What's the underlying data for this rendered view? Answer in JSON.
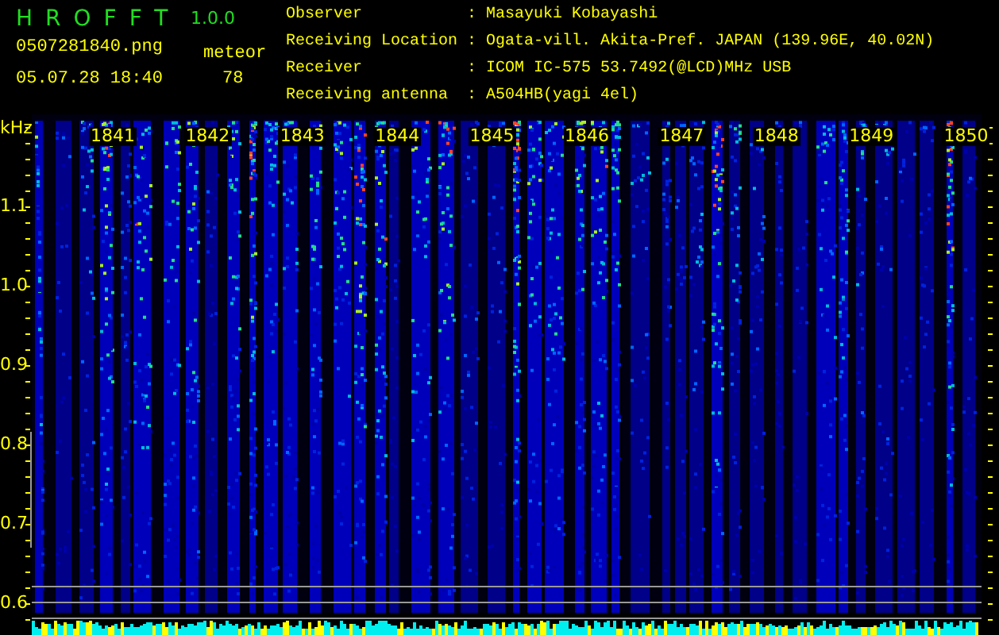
{
  "app": {
    "title": "HROFFT",
    "version": "1.0.0"
  },
  "file": {
    "name": "0507281840.png",
    "datetime": "05.07.28 18:40"
  },
  "meteor": {
    "label": "meteor",
    "count": "78"
  },
  "station_info": [
    {
      "label": "Observer",
      "separator": ":",
      "value": "Masayuki Kobayashi"
    },
    {
      "label": "Receiving Location",
      "separator": ":",
      "value": "Ogata-vill. Akita-Pref. JAPAN (139.96E, 40.02N)"
    },
    {
      "label": "Receiver",
      "separator": ":",
      "value": "ICOM IC-575 53.7492(@LCD)MHz USB"
    },
    {
      "label": "Receiving antenna",
      "separator": ":",
      "value": "A504HB(yagi 4el)"
    }
  ],
  "spectrogram": {
    "y_unit": "kHz",
    "y_ticks": [
      "1.1",
      "1.0",
      "0.9",
      "0.8",
      "0.7",
      "0.6"
    ],
    "time_labels": [
      "1841",
      "1842",
      "1843",
      "1844",
      "1845",
      "1846",
      "1847",
      "1848",
      "1849",
      "1850"
    ]
  }
}
